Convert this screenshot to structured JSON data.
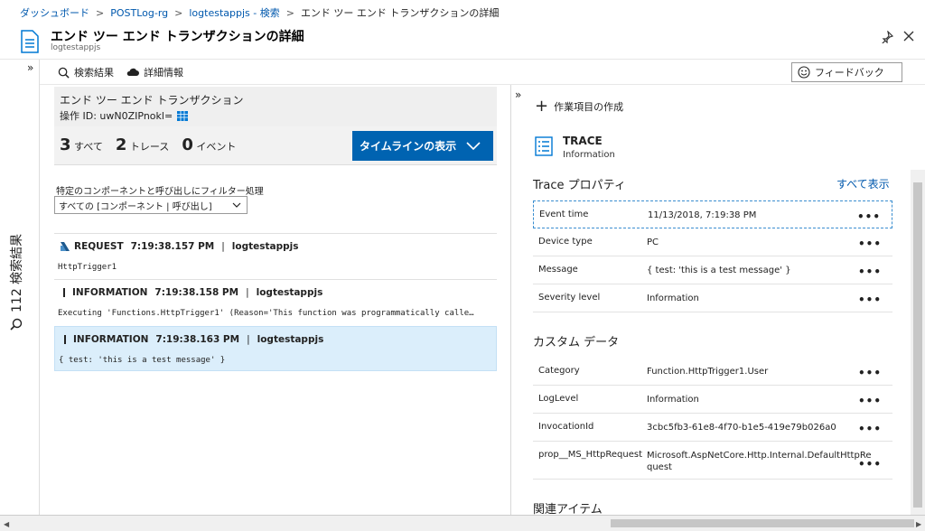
{
  "breadcrumb": {
    "items": [
      "ダッシュボード",
      "POSTLog-rg",
      "logtestappjs - 検索",
      "エンド ツー エンド トランザクションの詳細"
    ]
  },
  "header": {
    "title": "エンド ツー エンド トランザクションの詳細",
    "subtitle": "logtestappjs"
  },
  "leftrail": {
    "label": "112 検索結果",
    "expand": "»"
  },
  "toolbar": {
    "search_results": "検索結果",
    "details": "詳細情報",
    "feedback": "フィードバック"
  },
  "leftpanel": {
    "heading": "エンド ツー エンド トランザクション",
    "op_id": "操作 ID: uwN0ZIPnokl=",
    "counts": [
      {
        "num": "3",
        "label": "すべて"
      },
      {
        "num": "2",
        "label": "トレース"
      },
      {
        "num": "0",
        "label": "イベント"
      }
    ],
    "timeline_button": "タイムラインの表示",
    "filter_label": "特定のコンポーネントと呼び出しにフィルター処理",
    "filter_value": "すべての [コンポーネント | 呼び出し]",
    "items": [
      {
        "type": "REQUEST",
        "time": "7:19:38.157 PM",
        "app": "logtestappjs",
        "body": "HttpTrigger1"
      },
      {
        "type": "INFORMATION",
        "time": "7:19:38.158 PM",
        "app": "logtestappjs",
        "body": "Executing 'Functions.HttpTrigger1' (Reason='This function was programmatically calle…"
      },
      {
        "type": "INFORMATION",
        "time": "7:19:38.163 PM",
        "app": "logtestappjs",
        "body": "{ test: 'this is a test message' }"
      }
    ]
  },
  "rightpanel": {
    "expand": "»",
    "create_work_item": "作業項目の作成",
    "trace_title": "TRACE",
    "trace_sub": "Information",
    "props_heading": "Trace プロパティ",
    "show_all": "すべて表示",
    "props": [
      {
        "key": "Event time",
        "value": "11/13/2018, 7:19:38 PM"
      },
      {
        "key": "Device type",
        "value": "PC"
      },
      {
        "key": "Message",
        "value": "{ test: 'this is a test message' }"
      },
      {
        "key": "Severity level",
        "value": "Information"
      }
    ],
    "custom_heading": "カスタム データ",
    "custom": [
      {
        "key": "Category",
        "value": "Function.HttpTrigger1.User"
      },
      {
        "key": "LogLevel",
        "value": "Information"
      },
      {
        "key": "InvocationId",
        "value": "3cbc5fb3-61e8-4f70-b1e5-419e79b026a0"
      },
      {
        "key": "prop__MS_HttpRequest",
        "value": "Microsoft.AspNetCore.Http.Internal.DefaultHttpRequest"
      }
    ],
    "related_heading": "関連アイテム",
    "dots": "•••"
  },
  "colors": {
    "accent": "#0063b1",
    "selected": "#dbeefb",
    "link": "#0058ad"
  }
}
